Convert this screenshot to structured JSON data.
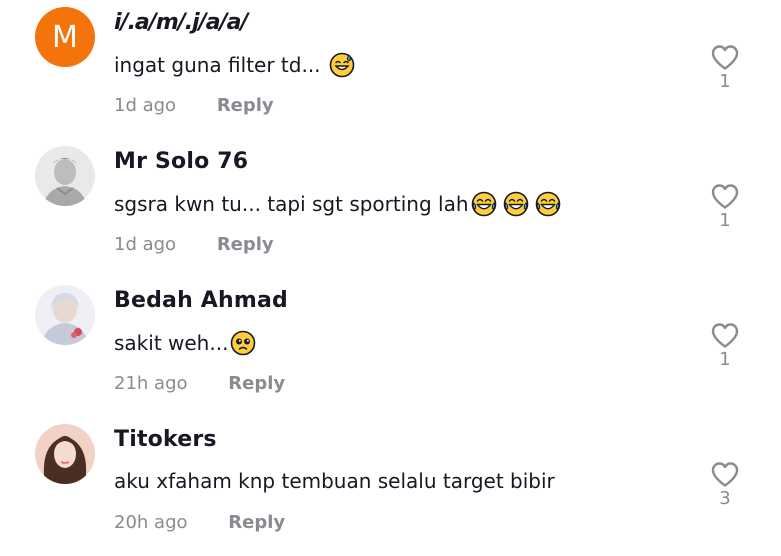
{
  "comments": [
    {
      "avatar_letter": "M",
      "username": "i/.a/m/.j/a/a/",
      "text": "ingat guna filter td...",
      "emojis": [
        "sweat-smile"
      ],
      "time": "1d ago",
      "reply_label": "Reply",
      "likes": "1"
    },
    {
      "username": "Mr Solo 76",
      "text": "sgsra kwn tu... tapi sgt sporting lah",
      "emojis": [
        "joy",
        "joy",
        "joy"
      ],
      "time": "1d ago",
      "reply_label": "Reply",
      "likes": "1"
    },
    {
      "username": "Bedah Ahmad",
      "text": "sakit weh...",
      "emojis": [
        "pleading"
      ],
      "time": "21h ago",
      "reply_label": "Reply",
      "likes": "1"
    },
    {
      "username": "Titokers",
      "text": "aku xfaham knp tembuan selalu target bibir",
      "emojis": [],
      "time": "20h ago",
      "reply_label": "Reply",
      "likes": "3"
    }
  ],
  "colors": {
    "avatar_orange": "#f4740b",
    "text_primary": "#161823",
    "text_secondary": "#8a8b91"
  }
}
